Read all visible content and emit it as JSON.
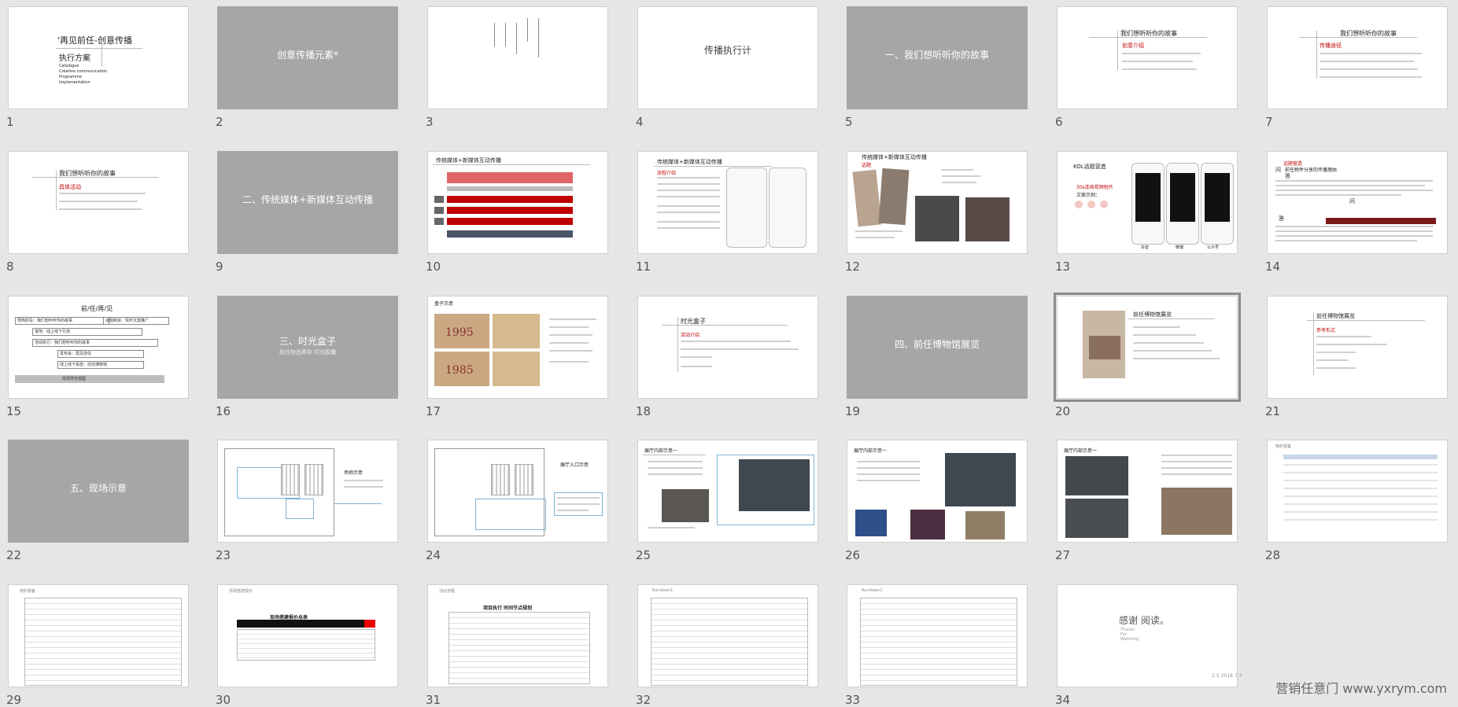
{
  "slides": [
    {
      "num": "1",
      "title": "'再见前任-创意传播",
      "sub1": "执行方案",
      "sub2": "Catalogue",
      "sub3": "Creative communication",
      "sub4": "Programme",
      "sub5": "implementation"
    },
    {
      "num": "2",
      "title": "创意传播元素*"
    },
    {
      "num": "3"
    },
    {
      "num": "4",
      "title": "传播执行计"
    },
    {
      "num": "5",
      "title": "一、我们想听听你的故事"
    },
    {
      "num": "6",
      "title": "我们想听听你的故事",
      "sub": "创意介绍"
    },
    {
      "num": "7",
      "title": "我们想听听你的故事",
      "sub": "传播途径"
    },
    {
      "num": "8",
      "title": "我们想听听你的故事",
      "sub": "具体活动"
    },
    {
      "num": "9",
      "title": "二、传统媒体+新媒体互动传播"
    },
    {
      "num": "10",
      "title": "传统媒体+新媒体互动传播"
    },
    {
      "num": "11",
      "title": "传统媒体+新媒体互动传播",
      "sub": "流程介绍"
    },
    {
      "num": "12",
      "title": "传统媒体+新媒体互动传播",
      "sub": "话题"
    },
    {
      "num": "13",
      "title": "KOL话题营造",
      "sub": "30s连续视频短片",
      "sub2": "文案示例：",
      "lbl1": "抖音",
      "lbl2": "微博",
      "lbl3": "公众号"
    },
    {
      "num": "14",
      "title": "话题营造",
      "sub": "问",
      "sub2": "前任物件分享的传播理由",
      "sub3": "答",
      "sub4": "问",
      "sub5": "答"
    },
    {
      "num": "15",
      "title": "前/任/再/见",
      "r1": "预热阶段：我们想听听你的故事",
      "r2": "话题制造：情怀文案推广",
      "r3": "落地：线上线下引流",
      "r4": "活动执行：我们想听听你的故事",
      "r5": "发布会：再见前任",
      "r6": "线上线下投放：前任博物馆",
      "r7": "现场导览视图"
    },
    {
      "num": "16",
      "title": "三、时光盒子",
      "sub": "前任物品寄存  时光胶囊"
    },
    {
      "num": "17",
      "title": "盒子示意",
      "y1": "1995",
      "y2": "1985"
    },
    {
      "num": "18",
      "title": "时光盒子",
      "sub": "活动介绍"
    },
    {
      "num": "19",
      "title": "四、前任博物馆展览"
    },
    {
      "num": "20",
      "title": "前任博物馆展览",
      "selected": "true"
    },
    {
      "num": "21",
      "title": "前任博物馆展览",
      "sub": "参考形式"
    },
    {
      "num": "22",
      "title": "五、现场示意"
    },
    {
      "num": "23",
      "title": "场地示意"
    },
    {
      "num": "24",
      "title": "展厅入口示意"
    },
    {
      "num": "25",
      "title": "展厅内部示意一"
    },
    {
      "num": "26",
      "title": "展厅内部示意一"
    },
    {
      "num": "27",
      "title": "展厅内部示意一"
    },
    {
      "num": "28",
      "title": "物料报备"
    },
    {
      "num": "29",
      "title": "物料报备"
    },
    {
      "num": "30",
      "title": "现场搭建报价",
      "sub": "现场搭建报价总表"
    },
    {
      "num": "31",
      "title": "活动流程",
      "sub": "项目执行 时间节点规划"
    },
    {
      "num": "32",
      "title": "Rundown1"
    },
    {
      "num": "33",
      "title": "Rundown2"
    },
    {
      "num": "34",
      "title": "感谢 阅读。",
      "sub": "Thanks",
      "sub2": "For",
      "sub3": "Watching"
    }
  ],
  "watermark": "营销任意门  www.yxrym.com",
  "corner": "2-5  2018.7.3"
}
